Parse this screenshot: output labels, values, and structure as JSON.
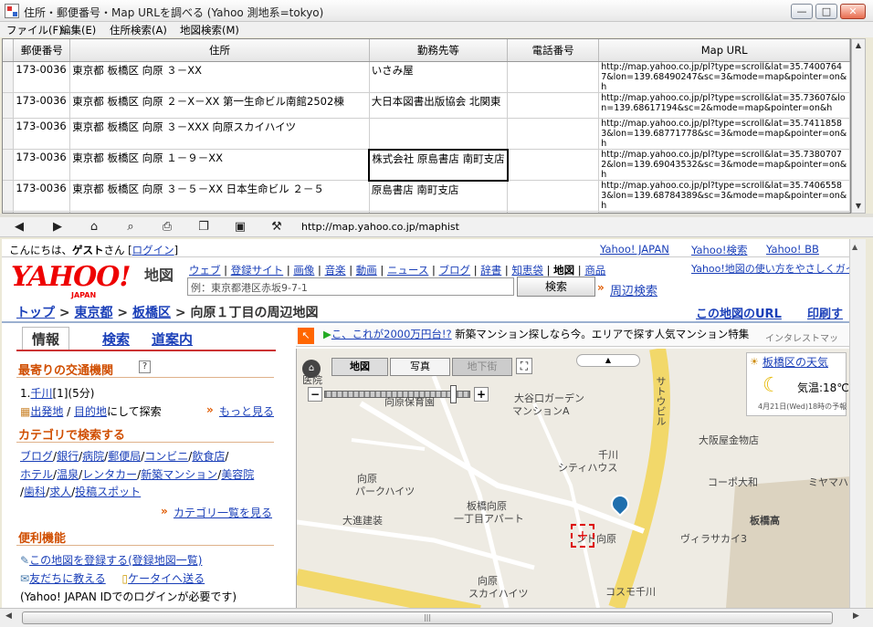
{
  "window": {
    "title": "住所・郵便番号・Map URLを調べる (Yahoo 測地系=tokyo)",
    "min": "—",
    "max": "□",
    "close": "✕"
  },
  "menu": [
    "ファイル(F)",
    "編集(E)",
    "住所検索(A)",
    "地図検索(M)"
  ],
  "table": {
    "headers": [
      "郵便番号",
      "住所",
      "勤務先等",
      "電話番号",
      "Map URL"
    ],
    "rows": [
      {
        "zip": "173-0036",
        "address": "東京都 板橋区 向原 ３－XX",
        "work": "いさみ屋",
        "phone": "",
        "url": "http://map.yahoo.co.jp/pl?type=scroll&lat=35.74007647&lon=139.68490247&sc=3&mode=map&pointer=on&h"
      },
      {
        "zip": "173-0036",
        "address": "東京都 板橋区 向原 ２－X－XX 第一生命ビル南館2502棟",
        "work": "大日本図書出版協会 北関東",
        "phone": "",
        "url": "http://map.yahoo.co.jp/pl?type=scroll&lat=35.73607&lon=139.68617194&sc=2&mode=map&pointer=on&h"
      },
      {
        "zip": "173-0036",
        "address": "東京都 板橋区 向原 ３－XXX 向原スカイハイツ",
        "work": "",
        "phone": "",
        "url": "http://map.yahoo.co.jp/pl?type=scroll&lat=35.74118583&lon=139.68771778&sc=3&mode=map&pointer=on&h"
      },
      {
        "zip": "173-0036",
        "address": "東京都 板橋区 向原 １－９－XX",
        "work": "株式会社 原島書店 南町支店",
        "phone": "",
        "url": "http://map.yahoo.co.jp/pl?type=scroll&lat=35.73807072&lon=139.69043532&sc=3&mode=map&pointer=on&h"
      },
      {
        "zip": "173-0036",
        "address": "東京都 板橋区 向原 ３－５－XX 日本生命ビル ２－５",
        "work": "原島書店 南町支店",
        "phone": "",
        "url": "http://map.yahoo.co.jp/pl?type=scroll&lat=35.74065583&lon=139.68784389&sc=3&mode=map&pointer=on&h"
      }
    ]
  },
  "browser": {
    "address": "http://map.yahoo.co.jp/maphist",
    "icons": [
      "back-icon",
      "forward-icon",
      "home-icon",
      "search-icon",
      "print-icon",
      "copy-icon",
      "save-icon",
      "tools-icon"
    ]
  },
  "web": {
    "greeting_pre": "こんにちは、",
    "greeting_user": "ゲスト",
    "greeting_post": "さん [",
    "login": "ログイン",
    "greeting_end": "]",
    "top_links": [
      "Yahoo! JAPAN",
      "Yahoo!検索",
      "Yahoo! BB"
    ],
    "logo": "YAHOO!",
    "logo_sub": "JAPAN",
    "chizu": "地図",
    "services": [
      "ウェブ",
      "登録サイト",
      "画像",
      "音楽",
      "動画",
      "ニュース",
      "ブログ",
      "辞書",
      "知恵袋",
      "地図",
      "商品"
    ],
    "help_link": "Yahoo!地図の使い方をやさしくガイ",
    "search_placeholder": "例：東京都港区赤坂9-7-1",
    "search_button": "検索",
    "nearby_search": "周辺検索",
    "breadcrumb": [
      "トップ",
      "東京都",
      "板橋区",
      "向原１丁目の周辺地図"
    ],
    "map_url_link": "この地図のURL",
    "print_link": "印刷す",
    "tabs": [
      "情報",
      "検索",
      "道案内"
    ],
    "transit_title": "最寄りの交通機関",
    "station_no": "1.",
    "station": "千川",
    "station_info": "[1](5分)",
    "dep": "出発地",
    "dest_sep": " / ",
    "dest": "目的地",
    "search_suffix": "にして探索",
    "more": "もっと見る",
    "category_title": "カテゴリで検索する",
    "categories1": [
      "ブログ",
      "銀行",
      "病院",
      "郵便局",
      "コンビニ",
      "飲食店"
    ],
    "categories2": [
      "ホテル",
      "温泉",
      "レンタカー",
      "新築マンション",
      "美容院"
    ],
    "categories3": [
      "歯科",
      "求人",
      "投稿スポット"
    ],
    "category_list": "カテゴリ一覧を見る",
    "convenience_title": "便利機能",
    "register": "この地図を登録する",
    "register_list": "(登録地図一覧)",
    "tell_friend": "友だちに教える",
    "send_mobile": "ケータイへ送る",
    "login_note": "(Yahoo! JAPAN IDでのログインが必要です)",
    "banner_link": "こ、これが2000万円台!?",
    "banner_text": "新築マンション探しなら今。エリアで探す人気マンション特集",
    "banner_extra": "インタレストマッ",
    "map_tabs": [
      "地図",
      "写真",
      "地下街"
    ],
    "weather_title": "板橋区の天気",
    "weather_temp": "気温:18℃",
    "weather_date": "4月21日(Wed)18時の予報",
    "map_labels": [
      "医院",
      "向原保育園",
      "大谷口ガーデン",
      "マンションA",
      "サトウビル",
      "大阪屋金物店",
      "千川",
      "シティハウス",
      "向原",
      "パークハイツ",
      "コーポ大和",
      "ミヤマハ",
      "板橋向原",
      "一丁目アパート",
      "大進建装",
      "ンド向原",
      "板橋高",
      "ヴィラサカイ3",
      "向原",
      "スカイハイツ",
      "コスモ千川"
    ]
  }
}
